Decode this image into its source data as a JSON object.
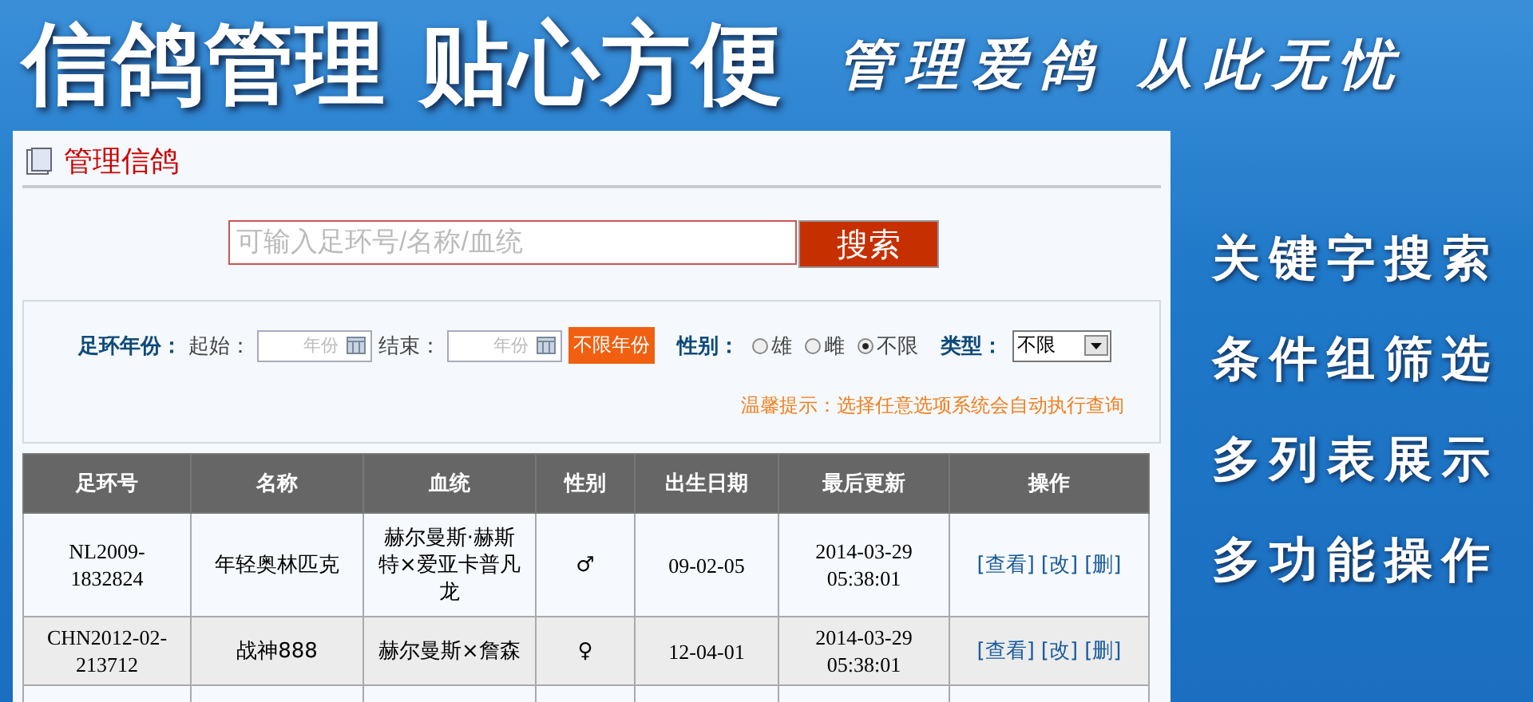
{
  "banner": {
    "title": "信鸽管理 贴心方便",
    "slogan": "管理爱鸽 从此无忧",
    "features": [
      "关键字搜索",
      "条件组筛选",
      "多列表展示",
      "多功能操作"
    ]
  },
  "panel": {
    "title": "管理信鸽"
  },
  "search": {
    "placeholder": "可输入足环号/名称/血统",
    "button": "搜索"
  },
  "filters": {
    "year_label": "足环年份：",
    "start_label": "起始：",
    "start_placeholder": "年份",
    "end_label": "结束：",
    "end_placeholder": "年份",
    "any_year_button": "不限年份",
    "sex_label": "性别：",
    "sex_options": [
      {
        "label": "雄",
        "selected": false
      },
      {
        "label": "雌",
        "selected": false
      },
      {
        "label": "不限",
        "selected": true
      }
    ],
    "type_label": "类型：",
    "type_value": "不限",
    "hint": "温馨提示：选择任意选项系统会自动执行查询"
  },
  "table": {
    "columns": [
      "足环号",
      "名称",
      "血统",
      "性别",
      "出生日期",
      "最后更新",
      "操作"
    ],
    "rows": [
      {
        "ring": "NL2009-1832824",
        "name": "年轻奥林匹克",
        "bloodline": "赫尔曼斯·赫斯特×爱亚卡普凡龙",
        "sex": "♂",
        "birth": "09-02-05",
        "updated": "2014-03-29 05:38:01",
        "actions": [
          "[查看]",
          "[改]",
          "[删]"
        ]
      },
      {
        "ring": "CHN2012-02-213712",
        "name": "战神888",
        "bloodline": "赫尔曼斯×詹森",
        "sex": "♀",
        "birth": "12-04-01",
        "updated": "2014-03-29 05:38:01",
        "actions": [
          "[查看]",
          "[改]",
          "[删]"
        ]
      }
    ]
  }
}
